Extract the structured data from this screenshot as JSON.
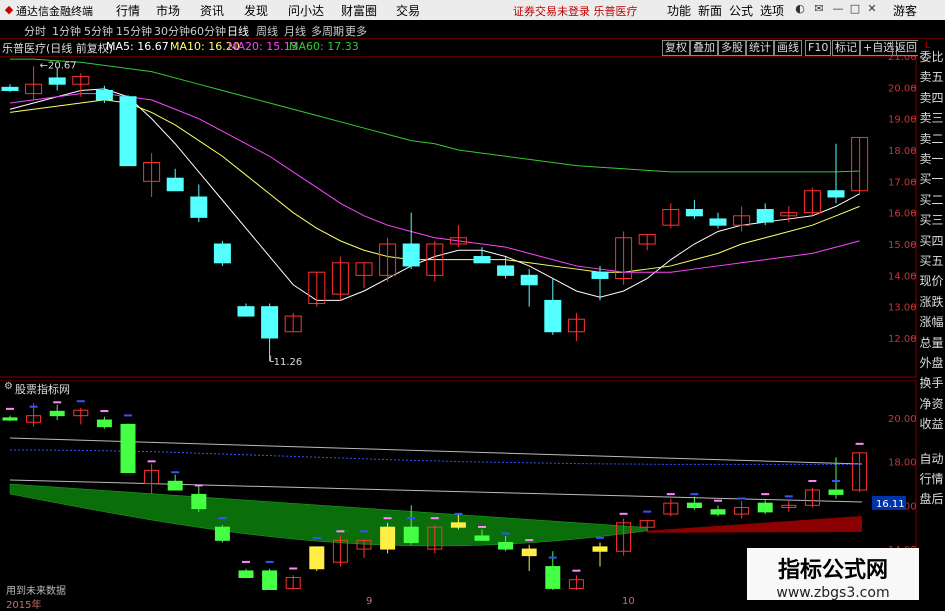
{
  "titlebar": {
    "app_name": "通达信金融终端",
    "menus": [
      "行情",
      "市场",
      "资讯",
      "发现",
      "问小达",
      "财富圈",
      "交易"
    ],
    "notice": "证券交易未登录 乐普医疗",
    "right_items": [
      "功能",
      "新面",
      "公式",
      "选项"
    ],
    "guest": "游客"
  },
  "periods": [
    "分时",
    "1分钟",
    "5分钟",
    "15分钟",
    "30分钟",
    "60分钟",
    "日线",
    "周线",
    "月线",
    "多周期",
    "更多"
  ],
  "active_period": "日线",
  "toolbar": {
    "info": "乐普医疗(日线 前复权)",
    "ma": [
      {
        "label": "MA5: 16.67",
        "color": "#ffffff"
      },
      {
        "label": "MA10: 16.20",
        "color": "#ffff66"
      },
      {
        "label": "MA20: 15.13",
        "color": "#ff44ff"
      },
      {
        "label": "MA60: 17.33",
        "color": "#33cc33"
      }
    ],
    "buttons": [
      "复权",
      "叠加",
      "多股",
      "统计",
      "画线",
      "F10",
      "标记",
      "+自选",
      "返回"
    ]
  },
  "main_axis": [
    "21.00",
    "20.00",
    "19.00",
    "18.00",
    "17.00",
    "16.00",
    "15.00",
    "14.00",
    "13.00",
    "12.00"
  ],
  "annotations": {
    "high": "20.67",
    "low": "11.26"
  },
  "sub_title": "股票指标网",
  "sub_axis": [
    "20.00",
    "18.00",
    "16.00",
    "14.00"
  ],
  "sub_value_tag": "16.11",
  "sidebar": {
    "corner": "L",
    "items": [
      "委比",
      "卖五",
      "卖四",
      "卖三",
      "卖二",
      "卖一",
      "买一",
      "买二",
      "买三",
      "买四",
      "买五",
      "现价",
      "涨跌",
      "涨幅",
      "总量",
      "外盘",
      "换手",
      "净资",
      "收益",
      "自动",
      "行情",
      "盘后"
    ]
  },
  "x_labels": [
    "2015年",
    "9",
    "10"
  ],
  "bottom_text": "用到未来数据",
  "watermark": {
    "line1": "指标公式网",
    "line2": "www.zbgs3.com"
  },
  "candles": [
    {
      "o": 20.0,
      "h": 20.1,
      "l": 19.85,
      "c": 19.9
    },
    {
      "o": 19.8,
      "h": 20.67,
      "l": 19.6,
      "c": 20.1
    },
    {
      "o": 20.3,
      "h": 20.6,
      "l": 19.9,
      "c": 20.1
    },
    {
      "o": 20.1,
      "h": 20.45,
      "l": 19.7,
      "c": 20.35
    },
    {
      "o": 19.9,
      "h": 20.05,
      "l": 19.5,
      "c": 19.6
    },
    {
      "o": 19.7,
      "h": 19.75,
      "l": 17.5,
      "c": 17.5
    },
    {
      "o": 17.0,
      "h": 17.9,
      "l": 16.5,
      "c": 17.6
    },
    {
      "o": 17.1,
      "h": 17.4,
      "l": 16.9,
      "c": 16.7
    },
    {
      "o": 16.5,
      "h": 16.9,
      "l": 15.7,
      "c": 15.85
    },
    {
      "o": 15.0,
      "h": 15.1,
      "l": 14.3,
      "c": 14.4
    },
    {
      "o": 13.0,
      "h": 13.1,
      "l": 12.7,
      "c": 12.7
    },
    {
      "o": 13.0,
      "h": 13.1,
      "l": 11.26,
      "c": 12.0
    },
    {
      "o": 12.2,
      "h": 12.8,
      "l": 12.2,
      "c": 12.7
    },
    {
      "o": 13.1,
      "h": 14.1,
      "l": 13.0,
      "c": 14.1
    },
    {
      "o": 13.4,
      "h": 14.6,
      "l": 13.2,
      "c": 14.4
    },
    {
      "o": 14.0,
      "h": 14.4,
      "l": 13.6,
      "c": 14.4
    },
    {
      "o": 14.0,
      "h": 15.2,
      "l": 13.8,
      "c": 15.0
    },
    {
      "o": 15.0,
      "h": 16.0,
      "l": 14.2,
      "c": 14.3
    },
    {
      "o": 14.0,
      "h": 15.1,
      "l": 13.8,
      "c": 15.0
    },
    {
      "o": 15.0,
      "h": 15.6,
      "l": 14.9,
      "c": 15.2
    },
    {
      "o": 14.6,
      "h": 14.9,
      "l": 14.4,
      "c": 14.4
    },
    {
      "o": 14.3,
      "h": 14.6,
      "l": 13.9,
      "c": 14.0
    },
    {
      "o": 14.0,
      "h": 14.2,
      "l": 13.0,
      "c": 13.7
    },
    {
      "o": 13.2,
      "h": 13.9,
      "l": 12.1,
      "c": 12.2
    },
    {
      "o": 12.2,
      "h": 12.8,
      "l": 11.9,
      "c": 12.6
    },
    {
      "o": 14.1,
      "h": 14.3,
      "l": 13.2,
      "c": 13.9
    },
    {
      "o": 13.9,
      "h": 15.4,
      "l": 13.7,
      "c": 15.2
    },
    {
      "o": 15.0,
      "h": 15.3,
      "l": 14.8,
      "c": 15.3
    },
    {
      "o": 15.6,
      "h": 16.3,
      "l": 15.5,
      "c": 16.1
    },
    {
      "o": 16.1,
      "h": 16.4,
      "l": 15.8,
      "c": 15.9
    },
    {
      "o": 15.8,
      "h": 16.0,
      "l": 15.5,
      "c": 15.6
    },
    {
      "o": 15.6,
      "h": 16.2,
      "l": 15.4,
      "c": 15.9
    },
    {
      "o": 16.1,
      "h": 16.3,
      "l": 15.6,
      "c": 15.7
    },
    {
      "o": 15.9,
      "h": 16.2,
      "l": 15.7,
      "c": 16.0
    },
    {
      "o": 16.0,
      "h": 16.8,
      "l": 15.9,
      "c": 16.7
    },
    {
      "o": 16.7,
      "h": 18.2,
      "l": 16.3,
      "c": 16.5
    },
    {
      "o": 16.7,
      "h": 18.4,
      "l": 16.6,
      "c": 18.4
    }
  ],
  "ma_lines": {
    "ma5": [
      19.3,
      19.5,
      19.7,
      19.9,
      19.95,
      19.7,
      19.0,
      18.2,
      17.3,
      16.4,
      15.5,
      14.6,
      13.7,
      13.2,
      13.2,
      13.5,
      13.9,
      14.3,
      14.6,
      14.8,
      14.8,
      14.6,
      14.3,
      13.9,
      13.5,
      13.3,
      13.5,
      13.9,
      14.5,
      15.0,
      15.4,
      15.6,
      15.7,
      15.8,
      15.9,
      16.2,
      16.6
    ],
    "ma10": [
      19.2,
      19.3,
      19.4,
      19.5,
      19.6,
      19.5,
      19.2,
      18.8,
      18.3,
      17.8,
      17.2,
      16.6,
      16.0,
      15.5,
      15.1,
      14.8,
      14.6,
      14.5,
      14.5,
      14.5,
      14.5,
      14.5,
      14.4,
      14.3,
      14.2,
      14.1,
      14.1,
      14.2,
      14.3,
      14.5,
      14.7,
      15.0,
      15.2,
      15.4,
      15.6,
      15.9,
      16.2
    ],
    "ma20": [
      19.5,
      19.6,
      19.7,
      19.8,
      19.8,
      19.7,
      19.6,
      19.3,
      19.0,
      18.6,
      18.2,
      17.8,
      17.3,
      16.8,
      16.3,
      15.9,
      15.6,
      15.4,
      15.2,
      15.1,
      15.0,
      14.9,
      14.7,
      14.5,
      14.3,
      14.2,
      14.1,
      14.1,
      14.1,
      14.2,
      14.3,
      14.4,
      14.5,
      14.6,
      14.7,
      14.9,
      15.1
    ],
    "ma60": [
      20.9,
      20.9,
      20.85,
      20.8,
      20.7,
      20.6,
      20.5,
      20.3,
      20.1,
      19.9,
      19.7,
      19.5,
      19.3,
      19.1,
      18.9,
      18.7,
      18.5,
      18.3,
      18.2,
      18.0,
      17.9,
      17.8,
      17.7,
      17.6,
      17.5,
      17.45,
      17.4,
      17.35,
      17.3,
      17.3,
      17.3,
      17.3,
      17.3,
      17.3,
      17.3,
      17.3,
      17.33
    ]
  },
  "colors": {
    "up": "#ff3232",
    "down": "#54ffff",
    "bg": "#000000",
    "grid": "#800000",
    "green_band": "#0a6e0a",
    "red_band": "#8b0000"
  }
}
